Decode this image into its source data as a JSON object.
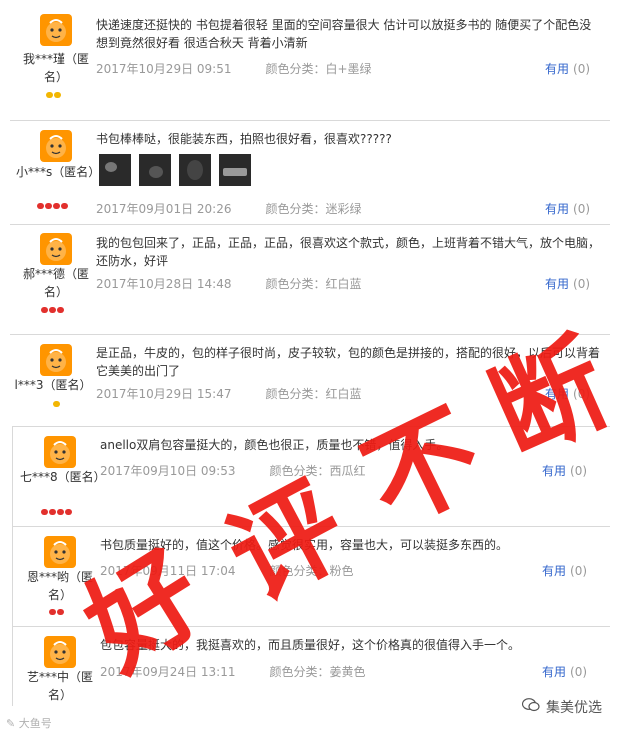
{
  "reviews": [
    {
      "user": "我***瑾（匿名）",
      "badge": "gold",
      "badge_count": 2,
      "content": "快递速度还挺快的 书包提着很轻 里面的空间容量很大 估计可以放挺多书的 随便买了个配色没想到竟然很好看 很适合秋天 背着小清新",
      "date": "2017年10月29日 09:51",
      "color": "颜色分类：白+墨绿",
      "has_images": false
    },
    {
      "user": "小***s（匿名）",
      "badge": "red",
      "badge_count": 4,
      "content": "书包棒棒哒，很能装东西，拍照也很好看，很喜欢?????",
      "date": "2017年09月01日 20:26",
      "color": "颜色分类：迷彩绿",
      "has_images": true
    },
    {
      "user": "郝***德（匿名）",
      "badge": "red",
      "badge_count": 3,
      "content": "我的包包回来了，正品，正品，正品，很喜欢这个款式，颜色，上班背着不错大气，放个电脑，还防水，好评",
      "date": "2017年10月28日 14:48",
      "color": "颜色分类：红白蓝",
      "has_images": false
    },
    {
      "user": "l***3（匿名）",
      "badge": "gold",
      "badge_count": 1,
      "content": "是正品，牛皮的，包的样子很时尚，皮子较软，包的颜色是拼接的，搭配的很好，以后可以背着它美美的出门了",
      "date": "2017年10月29日 15:47",
      "color": "颜色分类：红白蓝",
      "has_images": false
    },
    {
      "user": "七***8（匿名）",
      "badge": "red",
      "badge_count": 4,
      "content": "anello双肩包容量挺大的，颜色也很正，质量也不错，值得入手。",
      "date": "2017年09月10日 09:53",
      "color": "颜色分类：西瓜红",
      "has_images": false
    },
    {
      "user": "恩***哟（匿名）",
      "badge": "red",
      "badge_count": 2,
      "content": "书包质量挺好的，值这个价格。感觉很实用，容量也大，可以装挺多东西的。",
      "date": "2017年09月11日 17:04",
      "color": "颜色分类：粉色",
      "has_images": false
    },
    {
      "user": "艺***中（匿名）",
      "badge": "red",
      "badge_count": 4,
      "content": "包包容量挺大的，我挺喜欢的，而且质量很好，这个价格真的很值得入手一个。",
      "date": "2017年09月24日 13:11",
      "color": "颜色分类：姜黄色",
      "has_images": false
    }
  ],
  "useful_label": "有用",
  "useful_count": "(0)",
  "overlay_text": [
    "好",
    "评",
    "不",
    "断"
  ],
  "watermark_left": "大鱼号",
  "watermark_right": "集美优选",
  "colors": {
    "overlay": "#ee1c14",
    "avatar": "#ff9500",
    "link": "#3366cc"
  }
}
